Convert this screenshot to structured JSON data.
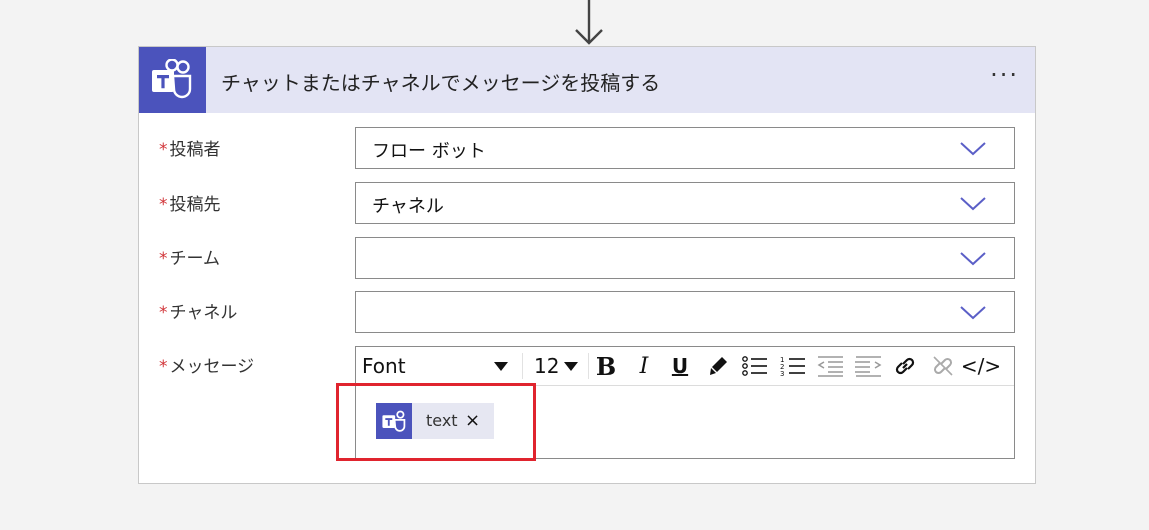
{
  "card": {
    "title": "チャットまたはチャネルでメッセージを投稿する",
    "more_label": "···",
    "brand_color": "#4b53bc",
    "header_color": "#e3e4f4"
  },
  "fields": [
    {
      "label": "投稿者",
      "value": "フロー ボット",
      "required": true
    },
    {
      "label": "投稿先",
      "value": "チャネル",
      "required": true
    },
    {
      "label": "チーム",
      "value": "",
      "required": true
    },
    {
      "label": "チャネル",
      "value": "",
      "required": true
    }
  ],
  "required_mark": "*",
  "message": {
    "label": "メッセージ",
    "toolbar": {
      "font_label": "Font",
      "size_label": "12",
      "bold_label": "B",
      "italic_label": "I",
      "underline_label": "U",
      "code_label": "</>"
    },
    "token": {
      "text": "text",
      "remove_label": "×",
      "icon": "teams-icon"
    }
  },
  "highlight_color": "#e0242e"
}
